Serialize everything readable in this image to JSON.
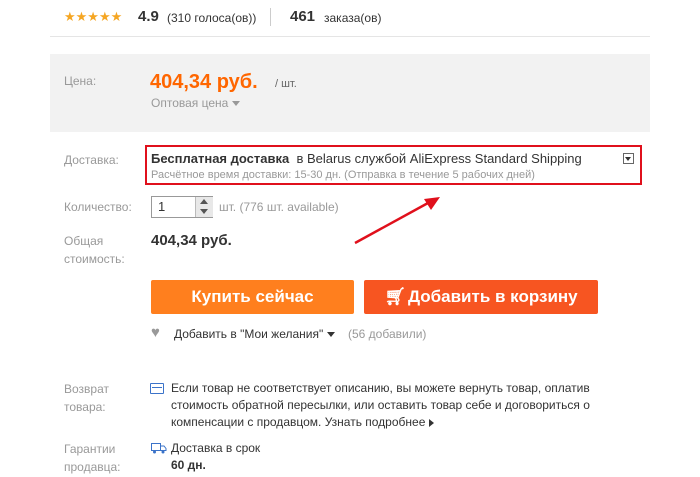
{
  "rating": {
    "stars": "★★★★★",
    "value": "4.9",
    "votes": "(310 голоса(ов))",
    "orders_count": "461",
    "orders_label": "заказа(ов)"
  },
  "price": {
    "label": "Цена:",
    "value": "404,34 руб.",
    "unit": "/ шт.",
    "wholesale": "Оптовая цена"
  },
  "shipping": {
    "label": "Доставка:",
    "free": "Бесплатная доставка",
    "to": "в Belarus службой AliExpress Standard Shipping",
    "estimate": "Расчётное время доставки: 15-30 дн. (Отправка в течение 5 рабочих дней)"
  },
  "quantity": {
    "label": "Количество:",
    "value": "1",
    "available": "шт. (776 шт. available)"
  },
  "total": {
    "label_line1": "Общая",
    "label_line2": "стоимость:",
    "value": "404,34 руб."
  },
  "buttons": {
    "buy_now": "Купить сейчас",
    "add_to_cart": "Добавить в корзину"
  },
  "wishlist": {
    "label": "Добавить в \"Мои желания\"",
    "count": "(56 добавили)"
  },
  "returns": {
    "label_line1": "Возврат",
    "label_line2": "товара:",
    "text": "Если товар не соответствует описанию, вы можете вернуть товар, оплатив стоимость обратной пересылки, или оставить товар себе и договориться о компенсации с продавцом.",
    "more": "Узнать подробнее"
  },
  "guarantee": {
    "label_line1": "Гарантии",
    "label_line2": "продавца:",
    "delivery": "Доставка в срок",
    "days": "60 дн."
  },
  "colors": {
    "price": "#ff6600",
    "buy_button": "#ff7f1e",
    "cart_button": "#f75521",
    "highlight": "#e0101c"
  },
  "icons": [
    "star-icon",
    "caret-down-icon",
    "dropdown-icon",
    "stepper-up-icon",
    "stepper-down-icon",
    "cart-icon",
    "heart-icon",
    "return-icon",
    "truck-icon",
    "arrow-annotation"
  ]
}
